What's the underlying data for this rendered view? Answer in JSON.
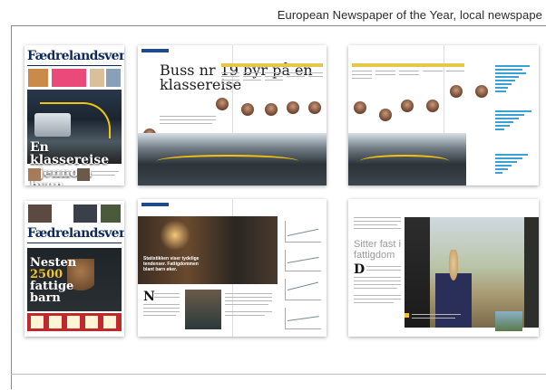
{
  "header": {
    "caption": "European Newspaper of the Year, local newspape"
  },
  "pages": {
    "front_1": {
      "masthead": "Fædrelandsvennen",
      "headline": "En klassereise gjennom byen"
    },
    "spread_1": {
      "headline": "Buss nr 19 byr på en klassereise"
    },
    "spread_2": {},
    "front_2": {
      "masthead": "Fædrelandsvennen",
      "headline_line1": "Nesten",
      "headline_number": "2500",
      "headline_line3": "fattige",
      "headline_line4": "barn"
    },
    "spread_3": {
      "headline": "Sitter fast i fattigdom",
      "dropcap": "D"
    },
    "spread_4": {
      "quote": "Statistikken viser tydelige tendenser. Fattigdommen blant barn øker.",
      "dropcap": "N"
    }
  },
  "colors": {
    "masthead_blue": "#0d2a5a",
    "route_yellow": "#f1c40f",
    "bar_blue": "#3aa0d6",
    "ad_red": "#c0292b"
  }
}
